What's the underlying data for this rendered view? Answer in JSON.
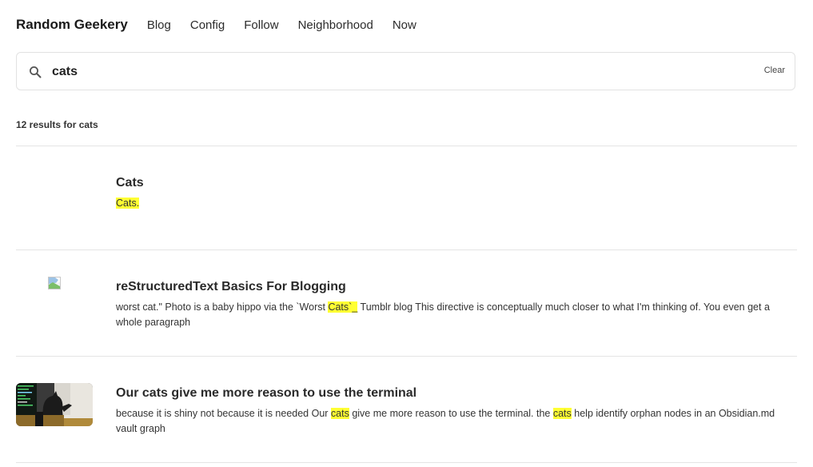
{
  "nav": {
    "brand": "Random Geekery",
    "links": [
      {
        "label": "Blog"
      },
      {
        "label": "Config"
      },
      {
        "label": "Follow"
      },
      {
        "label": "Neighborhood"
      },
      {
        "label": "Now"
      }
    ]
  },
  "search": {
    "value": "cats",
    "clear_label": "Clear",
    "icon": "search-icon"
  },
  "results_summary": "12 results for cats",
  "results": [
    {
      "title": "Cats",
      "thumbnail": "none",
      "excerpt": [
        {
          "text": "Cats.",
          "highlight": true
        }
      ]
    },
    {
      "title": "reStructuredText Basics For Blogging",
      "thumbnail": "broken-image-icon",
      "excerpt": [
        {
          "text": "worst cat.\" Photo is a baby hippo via the `Worst ",
          "highlight": false
        },
        {
          "text": "Cats`_",
          "highlight": true
        },
        {
          "text": " Tumblr blog This directive is conceptually much closer to what I'm thinking of. You even get a whole paragraph",
          "highlight": false
        }
      ]
    },
    {
      "title": "Our cats give me more reason to use the terminal",
      "thumbnail": "photo of a cat near a computer monitor",
      "excerpt": [
        {
          "text": "because it is shiny not because it is needed Our ",
          "highlight": false
        },
        {
          "text": "cats",
          "highlight": true
        },
        {
          "text": " give me more reason to use the terminal. the ",
          "highlight": false
        },
        {
          "text": "cats",
          "highlight": true
        },
        {
          "text": " help identify orphan nodes in an Obsidian.md vault graph",
          "highlight": false
        }
      ]
    }
  ],
  "colors": {
    "highlight": "#ffff33",
    "divider": "#e4e4e4",
    "text": "#222222"
  }
}
